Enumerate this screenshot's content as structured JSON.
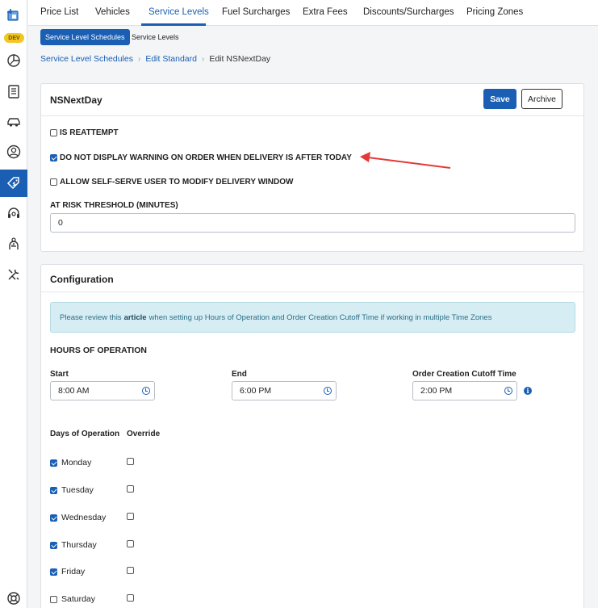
{
  "sidebar": {
    "badge": "DEV",
    "items": [
      {
        "icon": "app-logo-icon"
      },
      {
        "icon": "dashboard-pie-icon"
      },
      {
        "icon": "orders-list-icon"
      },
      {
        "icon": "vehicle-icon"
      },
      {
        "icon": "user-icon"
      },
      {
        "icon": "pricing-tag-icon",
        "active": true
      },
      {
        "icon": "support-headset-icon"
      },
      {
        "icon": "analytics-icon"
      },
      {
        "icon": "tools-icon"
      },
      {
        "icon": "help-lifebuoy-icon"
      }
    ]
  },
  "tabs": [
    "Price List",
    "Vehicles",
    "Service Levels",
    "Fuel Surcharges",
    "Extra Fees",
    "Discounts/Surcharges",
    "Pricing Zones"
  ],
  "active_tab": "Service Levels",
  "subtabs": {
    "primary": "Service Level Schedules",
    "secondary": "Service Levels"
  },
  "breadcrumb": {
    "level1": "Service Level Schedules",
    "level2": "Edit Standard",
    "current": "Edit NSNextDay",
    "separator": "›"
  },
  "service_panel": {
    "title": "NSNextDay",
    "save_label": "Save",
    "archive_label": "Archive",
    "options": [
      {
        "label": "IS REATTEMPT",
        "checked": false
      },
      {
        "label": "DO NOT DISPLAY WARNING ON ORDER WHEN DELIVERY IS AFTER TODAY",
        "checked": true
      },
      {
        "label": "ALLOW SELF-SERVE USER TO MODIFY DELIVERY WINDOW",
        "checked": false
      }
    ],
    "threshold_label": "AT RISK THRESHOLD (MINUTES)",
    "threshold_value": "0"
  },
  "config_panel": {
    "title": "Configuration",
    "banner": {
      "before": "Please review this",
      "link": "article",
      "after": "when setting up Hours of Operation and Order Creation Cutoff Time if working in multiple Time Zones"
    },
    "hours_heading": "HOURS OF OPERATION",
    "start_label": "Start",
    "start_value": "8:00 AM",
    "end_label": "End",
    "end_value": "6:00 PM",
    "cutoff_label": "Order Creation Cutoff Time",
    "cutoff_value": "2:00 PM",
    "days_header": "Days of Operation",
    "override_header": "Override",
    "days": [
      {
        "label": "Monday",
        "checked": true,
        "override": false
      },
      {
        "label": "Tuesday",
        "checked": true,
        "override": false
      },
      {
        "label": "Wednesday",
        "checked": true,
        "override": false
      },
      {
        "label": "Thursday",
        "checked": true,
        "override": false
      },
      {
        "label": "Friday",
        "checked": true,
        "override": false
      },
      {
        "label": "Saturday",
        "checked": false,
        "override": false
      }
    ]
  },
  "colors": {
    "accent": "#1a5fb4",
    "annotation_arrow": "#e53935",
    "banner_bg": "#d7edf4"
  }
}
